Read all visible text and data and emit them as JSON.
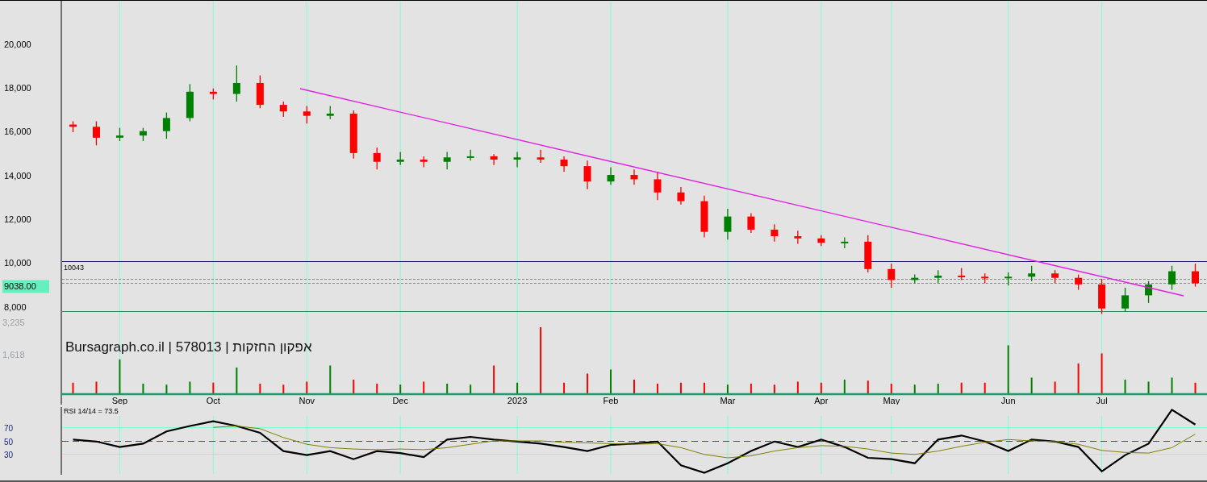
{
  "price_panel": {
    "current_price": "9038.00",
    "chart_data": {
      "type": "candlestick",
      "grid": true,
      "ylim": [
        3950,
        21990
      ],
      "yticks": [
        {
          "value": 8000,
          "label": "8,000"
        },
        {
          "value": 10000,
          "label": "10,000"
        },
        {
          "value": 12000,
          "label": "12,000"
        },
        {
          "value": 14000,
          "label": "14,000"
        },
        {
          "value": 16000,
          "label": "16,000"
        },
        {
          "value": 18000,
          "label": "18,000"
        },
        {
          "value": 20000,
          "label": "20,000"
        }
      ],
      "categories": [
        null,
        null,
        "Sep",
        null,
        null,
        null,
        "Oct",
        null,
        null,
        null,
        "Nov",
        null,
        null,
        null,
        "Dec",
        null,
        null,
        null,
        null,
        "2023",
        null,
        null,
        null,
        "Feb",
        null,
        null,
        null,
        null,
        "Mar",
        null,
        null,
        null,
        "Apr",
        null,
        null,
        "May",
        null,
        null,
        null,
        null,
        "Jun",
        null,
        null,
        null,
        "Jul",
        null,
        null,
        null,
        null
      ],
      "ohlc": [
        [
          16300,
          16450,
          15950,
          16200
        ],
        [
          16200,
          16450,
          15350,
          15700
        ],
        [
          15700,
          16150,
          15550,
          15800
        ],
        [
          15800,
          16150,
          15550,
          16000
        ],
        [
          16000,
          16850,
          15650,
          16600
        ],
        [
          16600,
          18150,
          16450,
          17800
        ],
        [
          17800,
          17950,
          17450,
          17700
        ],
        [
          17700,
          19000,
          17350,
          18200
        ],
        [
          18200,
          18550,
          17050,
          17200
        ],
        [
          17200,
          17350,
          16650,
          16900
        ],
        [
          16900,
          17150,
          16350,
          16700
        ],
        [
          16700,
          17150,
          16550,
          16800
        ],
        [
          16800,
          16950,
          14750,
          15000
        ],
        [
          15000,
          15250,
          14250,
          14600
        ],
        [
          14600,
          15050,
          14450,
          14700
        ],
        [
          14700,
          14850,
          14350,
          14600
        ],
        [
          14600,
          15050,
          14250,
          14800
        ],
        [
          14800,
          15150,
          14650,
          14850
        ],
        [
          14850,
          14950,
          14450,
          14700
        ],
        [
          14700,
          15050,
          14350,
          14800
        ],
        [
          14800,
          15150,
          14550,
          14700
        ],
        [
          14700,
          14850,
          14150,
          14400
        ],
        [
          14400,
          14650,
          13350,
          13700
        ],
        [
          13700,
          14350,
          13550,
          14000
        ],
        [
          14000,
          14250,
          13550,
          13800
        ],
        [
          13800,
          14150,
          12850,
          13200
        ],
        [
          13200,
          13450,
          12650,
          12800
        ],
        [
          12800,
          13050,
          11150,
          11400
        ],
        [
          11400,
          12450,
          11050,
          12100
        ],
        [
          12100,
          12250,
          11350,
          11500
        ],
        [
          11500,
          11750,
          10950,
          11200
        ],
        [
          11200,
          11450,
          10850,
          11100
        ],
        [
          11100,
          11250,
          10750,
          10900
        ],
        [
          10900,
          11150,
          10650,
          10950
        ],
        [
          10950,
          11250,
          9550,
          9700
        ],
        [
          9700,
          9950,
          8850,
          9200
        ],
        [
          9200,
          9450,
          9050,
          9300
        ],
        [
          9300,
          9650,
          9050,
          9400
        ],
        [
          9400,
          9750,
          9200,
          9350
        ],
        [
          9350,
          9500,
          9050,
          9300
        ],
        [
          9300,
          9550,
          8950,
          9350
        ],
        [
          9350,
          9850,
          9150,
          9500
        ],
        [
          9500,
          9650,
          9050,
          9300
        ],
        [
          9300,
          9450,
          8750,
          9000
        ],
        [
          9000,
          9250,
          7650,
          7900
        ],
        [
          7900,
          8850,
          7750,
          8500
        ],
        [
          8500,
          9150,
          8150,
          9000
        ],
        [
          9000,
          9850,
          8750,
          9600
        ],
        [
          9600,
          9950,
          8900,
          9050
        ]
      ],
      "ref_lines": [
        {
          "axis": "y",
          "value": 10043,
          "label": "10043",
          "color": "#1a1a6e"
        },
        {
          "axis": "y",
          "value": 9215,
          "color": "#8a8a8a"
        },
        {
          "axis": "y",
          "value": 9031,
          "color": "#8a8a8a"
        },
        {
          "axis": "y",
          "value": 7743,
          "color": "#2e8b57"
        }
      ]
    }
  },
  "source_label": "Bursagraph.co.il | 578013 | אפקון החזקות",
  "volume_panel": {
    "chart_data": {
      "type": "bar",
      "ylim": [
        0,
        3235
      ],
      "yticks": [
        {
          "value": 1618,
          "label": "1,618"
        },
        {
          "value": 3235,
          "label": "3,235"
        }
      ],
      "categories": [
        null,
        null,
        null,
        null,
        null,
        null,
        null,
        null,
        null,
        null,
        null,
        null,
        null,
        null,
        null,
        null,
        null,
        null,
        null,
        null,
        null,
        null,
        null,
        null,
        null,
        null,
        null,
        null,
        null,
        null,
        null,
        null,
        null,
        null,
        null,
        null,
        null,
        null,
        null,
        null,
        null,
        null,
        null,
        null,
        null,
        null,
        null,
        null,
        null
      ],
      "series": [
        {
          "values": [
            250,
            300,
            1400,
            200,
            150,
            300,
            250,
            1000,
            200,
            150,
            300,
            1100,
            400,
            200,
            150,
            300,
            200,
            150,
            1100,
            250,
            3000,
            250,
            700,
            900,
            400,
            200,
            250,
            250,
            150,
            200,
            150,
            300,
            250,
            400,
            350,
            200,
            150,
            200,
            250,
            250,
            2100,
            500,
            300,
            1200,
            1700,
            400,
            300,
            500,
            250
          ]
        }
      ]
    }
  },
  "rsi_panel": {
    "title": "RSI 14/14 = 73.5",
    "chart_data": {
      "type": "line",
      "grid": true,
      "ylim": [
        0,
        100
      ],
      "yticks": [
        {
          "value": 30,
          "label": "30"
        },
        {
          "value": 50,
          "label": "50"
        },
        {
          "value": 70,
          "label": "70"
        }
      ],
      "categories": [
        null,
        null,
        null,
        null,
        null,
        null,
        null,
        null,
        null,
        null,
        null,
        null,
        null,
        null,
        null,
        null,
        null,
        null,
        null,
        null,
        null,
        null,
        null,
        null,
        null,
        null,
        null,
        null,
        null,
        null,
        null,
        null,
        null,
        null,
        null,
        null,
        null,
        null,
        null,
        null,
        null,
        null,
        null,
        null,
        null,
        null,
        null,
        null,
        null
      ],
      "ref_lines": [
        {
          "axis": "y",
          "value": 70,
          "color": "#7fffd4"
        },
        {
          "axis": "y",
          "value": 50,
          "color": "#ff0000"
        },
        {
          "axis": "y",
          "value": 30,
          "color": "#7fffd4"
        }
      ],
      "series": [
        {
          "color": "#000000",
          "values": [
            52,
            49,
            41,
            46,
            64,
            72,
            79,
            72,
            62,
            35,
            29,
            35,
            23,
            35,
            32,
            26,
            52,
            56,
            52,
            49,
            46,
            41,
            35,
            44,
            46,
            49,
            14,
            3,
            17,
            35,
            49,
            41,
            52,
            41,
            25,
            23,
            17,
            52,
            58,
            49,
            35,
            52,
            49,
            41,
            5,
            29,
            46,
            96,
            74
          ]
        },
        {
          "color": "#808000",
          "values": [
            null,
            null,
            null,
            null,
            null,
            null,
            70,
            72,
            68,
            55,
            45,
            40,
            38,
            37,
            38,
            37,
            40,
            45,
            50,
            50,
            50,
            48,
            47,
            46,
            45,
            46,
            40,
            30,
            25,
            28,
            35,
            40,
            43,
            42,
            38,
            32,
            30,
            35,
            42,
            48,
            52,
            50,
            49,
            45,
            36,
            33,
            32,
            40,
            60
          ]
        }
      ]
    }
  }
}
